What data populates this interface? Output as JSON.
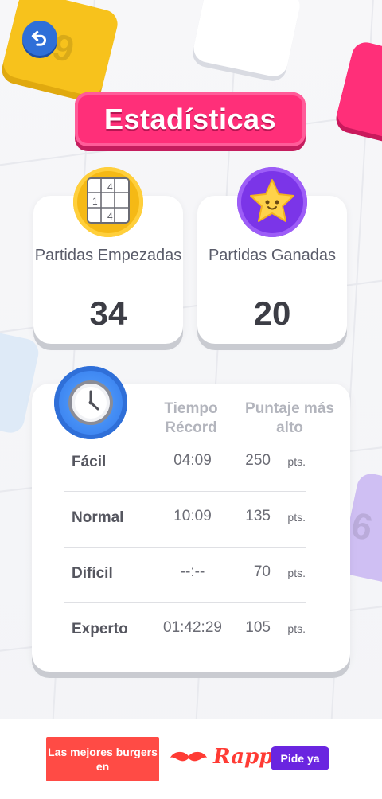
{
  "header": {
    "title": "Estadísticas"
  },
  "stats": {
    "started": {
      "label": "Partidas Empezadas",
      "value": "34"
    },
    "won": {
      "label": "Partidas Ganadas",
      "value": "20"
    }
  },
  "records": {
    "columns": {
      "time": "Tiempo Récord",
      "score": "Puntaje más alto"
    },
    "rows": [
      {
        "level": "Fácil",
        "time": "04:09",
        "score": "250",
        "unit": "pts."
      },
      {
        "level": "Normal",
        "time": "10:09",
        "score": "135",
        "unit": "pts."
      },
      {
        "level": "Difícil",
        "time": "--:--",
        "score": "70",
        "unit": "pts."
      },
      {
        "level": "Experto",
        "time": "01:42:29",
        "score": "105",
        "unit": "pts."
      }
    ]
  },
  "ad": {
    "text": "Las mejores burgers en",
    "brand": "Rappi",
    "cta": "Pide ya"
  },
  "decor": {
    "tile_yellow_number": "9",
    "tile_purple_number": "6"
  },
  "icons": {
    "back": "back-arrow-icon",
    "sudoku": "sudoku-grid-icon",
    "star": "star-icon",
    "clock": "clock-icon",
    "mustache": "mustache-icon"
  }
}
